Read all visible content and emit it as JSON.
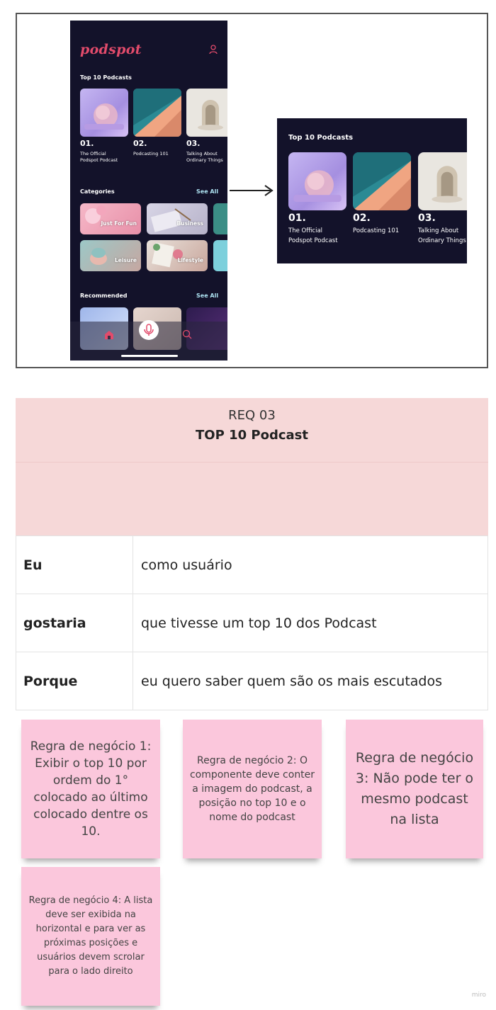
{
  "app": {
    "logo": "podspot",
    "sections": {
      "top10_title": "Top 10 Podcasts",
      "categories_title": "Categories",
      "recommended_title": "Recommended",
      "see_all": "See All"
    },
    "top10": [
      {
        "position": "01.",
        "name_line1": "The Official",
        "name_line2": "Podspot Podcast"
      },
      {
        "position": "02.",
        "name_line1": "Podcasting 101",
        "name_line2": ""
      },
      {
        "position": "03.",
        "name_line1": "Talking About",
        "name_line2": "Ordinary Things"
      }
    ],
    "categories": [
      "Just For Fun",
      "Business",
      "Leisure",
      "Lifestyle"
    ],
    "nav": [
      "home-icon",
      "microphone-icon",
      "search-icon"
    ]
  },
  "zoom": {
    "title": "Top 10 Podcasts",
    "items": [
      {
        "position": "01.",
        "name_line1": "The Official",
        "name_line2": "Podspot Podcast"
      },
      {
        "position": "02.",
        "name_line1": "Podcasting 101",
        "name_line2": ""
      },
      {
        "position": "03.",
        "name_line1": "Talking About",
        "name_line2": "Ordinary Things"
      }
    ]
  },
  "requirement": {
    "code": "REQ 03",
    "title": "TOP 10 Podcast",
    "rows": [
      {
        "key": "Eu",
        "value": "como usuário"
      },
      {
        "key": "gostaria",
        "value": "que tivesse um top 10 dos Podcast"
      },
      {
        "key": "Porque",
        "value": "eu quero saber quem são os mais escutados"
      }
    ]
  },
  "rules": [
    "Regra de negócio 1: Exibir o top 10 por ordem do 1° colocado ao último colocado dentre os 10.",
    "Regra de negócio 2: O componente deve conter a imagem do podcast, a posição no top 10 e o nome do podcast",
    "Regra de negócio 3: Não pode ter o mesmo podcast na lista",
    "Regra de negócio 4: A lista deve ser exibida na horizontal e para ver as próximas posições e usuários devem scrolar para o lado  direito"
  ],
  "watermark": "miro",
  "colors": {
    "phone_bg": "#13122a",
    "brand": "#e24b6b",
    "see_all": "#aee3f2",
    "req_header": "#f6d8d8",
    "sticky": "#fbc7dc"
  }
}
